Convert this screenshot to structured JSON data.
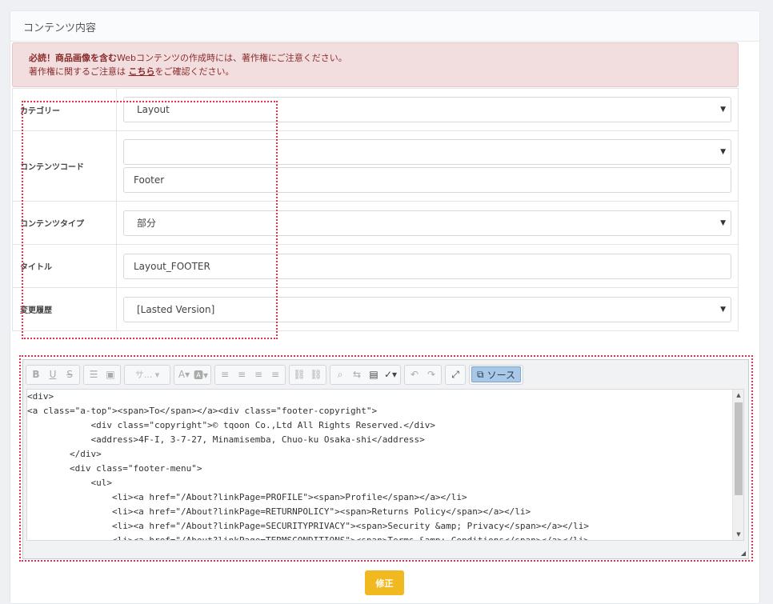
{
  "panel": {
    "title": "コンテンツ内容"
  },
  "alert": {
    "line1_bold": "必読！商品画像を含む",
    "line1_rest": "Webコンテンツの作成時には、著作権にご注意ください。",
    "line2_pre": "著作権に関するご注意は",
    "line2_link": "こちら",
    "line2_post": "をご確認ください。"
  },
  "form": {
    "category_label": "カテゴリー",
    "category_value": "Layout",
    "content_code_label": "コンテンツコード",
    "content_code_select": "",
    "content_code_value": "Footer",
    "content_type_label": "コンテンツタイプ",
    "content_type_value": "部分",
    "title_label": "タイトル",
    "title_value": "Layout_FOOTER",
    "history_label": "変更履歴",
    "history_value": "[Lasted Version]"
  },
  "editor": {
    "font_placeholder": "サ...",
    "source_label": "ソース",
    "code": "<div>\n<a class=\"a-top\"><span>To</span></a><div class=\"footer-copyright\">\n            <div class=\"copyright\">© tqoon Co.,Ltd All Rights Reserved.</div>\n            <address>4F-I, 3-7-27, Minamisemba, Chuo-ku Osaka-shi</address>\n        </div>\n        <div class=\"footer-menu\">\n            <ul>\n                <li><a href=\"/About?linkPage=PROFILE\"><span>Profile</span></a></li>\n                <li><a href=\"/About?linkPage=RETURNPOLICY\"><span>Returns Policy</span></a></li>\n                <li><a href=\"/About?linkPage=SECURITYPRIVACY\"><span>Security &amp; Privacy</span></a></li>\n                <li><a href=\"/About?linkPage=TERMSCONDITIONS\"><span>Terms &amp; Conditions</span></a></li>"
  },
  "submit_label": "修正",
  "colors": {
    "accent": "#f0b91f",
    "alert_bg": "#f2dede",
    "alert_text": "#8a2b2b",
    "highlight": "#e0334a"
  }
}
